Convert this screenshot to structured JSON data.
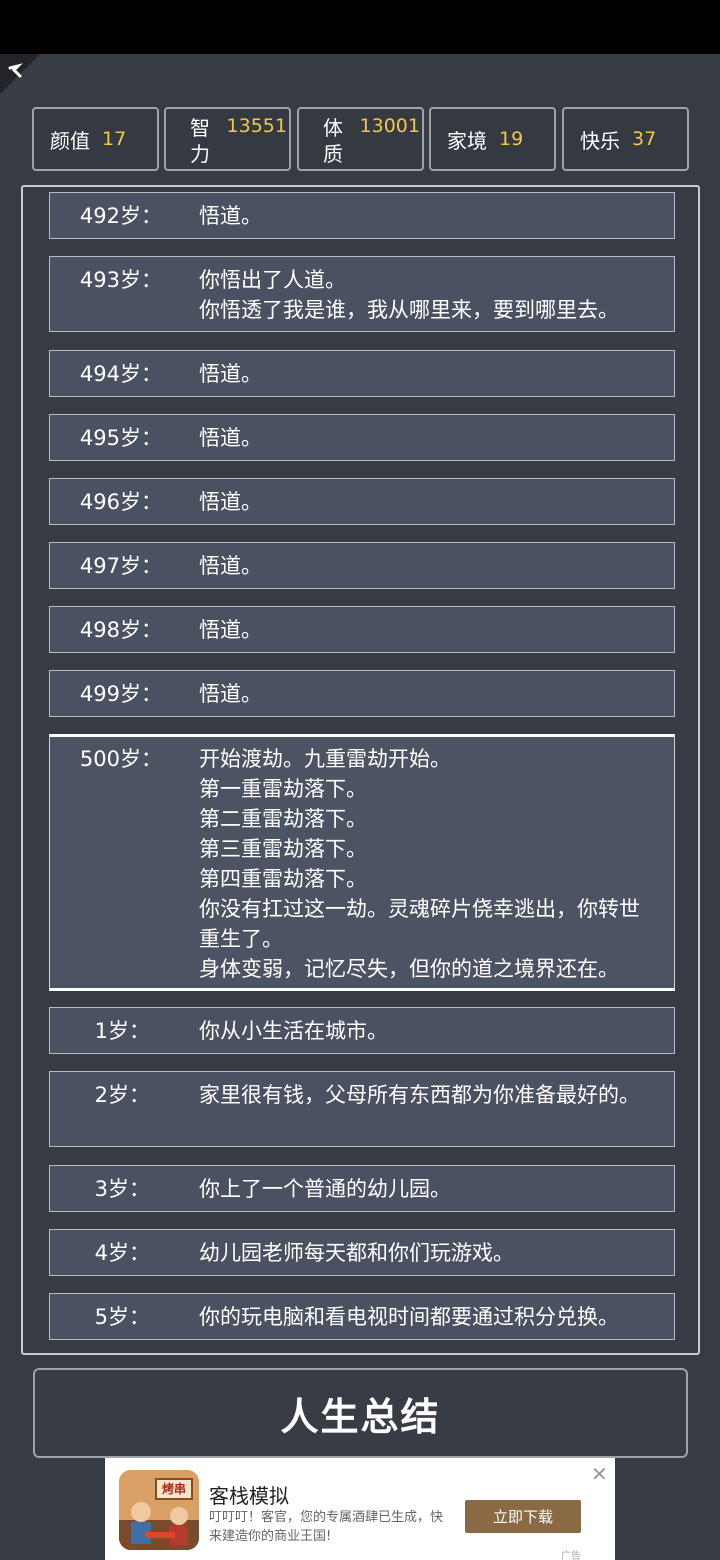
{
  "stats": [
    {
      "label": "颜值",
      "value": "17"
    },
    {
      "label": "智力",
      "value": "13551"
    },
    {
      "label": "体质",
      "value": "13001"
    },
    {
      "label": "家境",
      "value": "19"
    },
    {
      "label": "快乐",
      "value": "37"
    }
  ],
  "log": [
    {
      "age": "492岁：",
      "events": [
        "悟道。"
      ]
    },
    {
      "age": "493岁：",
      "events": [
        "你悟出了人道。",
        "你悟透了我是谁，我从哪里来，要到哪里去。"
      ]
    },
    {
      "age": "494岁：",
      "events": [
        "悟道。"
      ]
    },
    {
      "age": "495岁：",
      "events": [
        "悟道。"
      ]
    },
    {
      "age": "496岁：",
      "events": [
        "悟道。"
      ]
    },
    {
      "age": "497岁：",
      "events": [
        "悟道。"
      ]
    },
    {
      "age": "498岁：",
      "events": [
        "悟道。"
      ]
    },
    {
      "age": "499岁：",
      "events": [
        "悟道。"
      ]
    },
    {
      "age": "500岁：",
      "events": [
        "开始渡劫。九重雷劫开始。",
        "第一重雷劫落下。",
        "第二重雷劫落下。",
        "第三重雷劫落下。",
        "第四重雷劫落下。",
        "你没有扛过这一劫。灵魂碎片侥幸逃出，你转世重生了。",
        "身体变弱，记忆尽失，但你的道之境界还在。"
      ]
    },
    {
      "age": "1岁：",
      "events": [
        "你从小生活在城市。"
      ]
    },
    {
      "age": "2岁：",
      "events": [
        "家里很有钱，父母所有东西都为你准备最好的。"
      ]
    },
    {
      "age": "3岁：",
      "events": [
        "你上了一个普通的幼儿园。"
      ]
    },
    {
      "age": "4岁：",
      "events": [
        "幼儿园老师每天都和你们玩游戏。"
      ]
    },
    {
      "age": "5岁：",
      "events": [
        "你的玩电脑和看电视时间都要通过积分兑换。"
      ]
    }
  ],
  "summary_button": "人生总结",
  "ad": {
    "icon_text": "烤串",
    "title": "客栈模拟",
    "description": "叮叮叮！客官，您的专属酒肆已生成，快来建造你的商业王国!",
    "cta": "立即下载",
    "close": "✕",
    "tag": "广告"
  }
}
